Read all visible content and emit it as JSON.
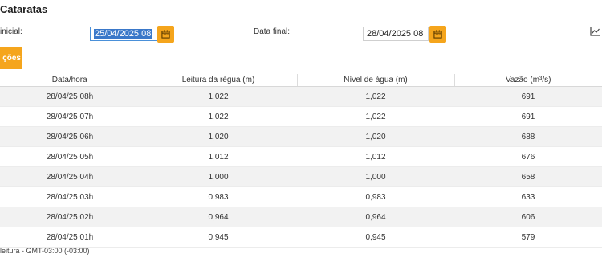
{
  "header": {
    "title": "Cataratas"
  },
  "filters": {
    "start_label": "inicial:",
    "start_value": "25/04/2025 08",
    "end_label": "Data final:",
    "end_value": "28/04/2025 08"
  },
  "action_button_label": "ções",
  "table": {
    "columns": [
      "Data/hora",
      "Leitura da régua (m)",
      "Nível de água (m)",
      "Vazão (m³/s)"
    ],
    "rows": [
      [
        "28/04/25 08h",
        "1,022",
        "1,022",
        "691"
      ],
      [
        "28/04/25 07h",
        "1,022",
        "1,022",
        "691"
      ],
      [
        "28/04/25 06h",
        "1,020",
        "1,020",
        "688"
      ],
      [
        "28/04/25 05h",
        "1,012",
        "1,012",
        "676"
      ],
      [
        "28/04/25 04h",
        "1,000",
        "1,000",
        "658"
      ],
      [
        "28/04/25 03h",
        "0,983",
        "0,983",
        "633"
      ],
      [
        "28/04/25 02h",
        "0,964",
        "0,964",
        "606"
      ],
      [
        "28/04/25 01h",
        "0,945",
        "0,945",
        "579"
      ]
    ]
  },
  "footnote": "leitura - GMT-03:00 (-03:00)",
  "icons": {
    "calendar": "calendar-icon",
    "chart": "line-chart-icon"
  },
  "colors": {
    "accent": "#f5a51c",
    "selection": "#3a78c9"
  }
}
